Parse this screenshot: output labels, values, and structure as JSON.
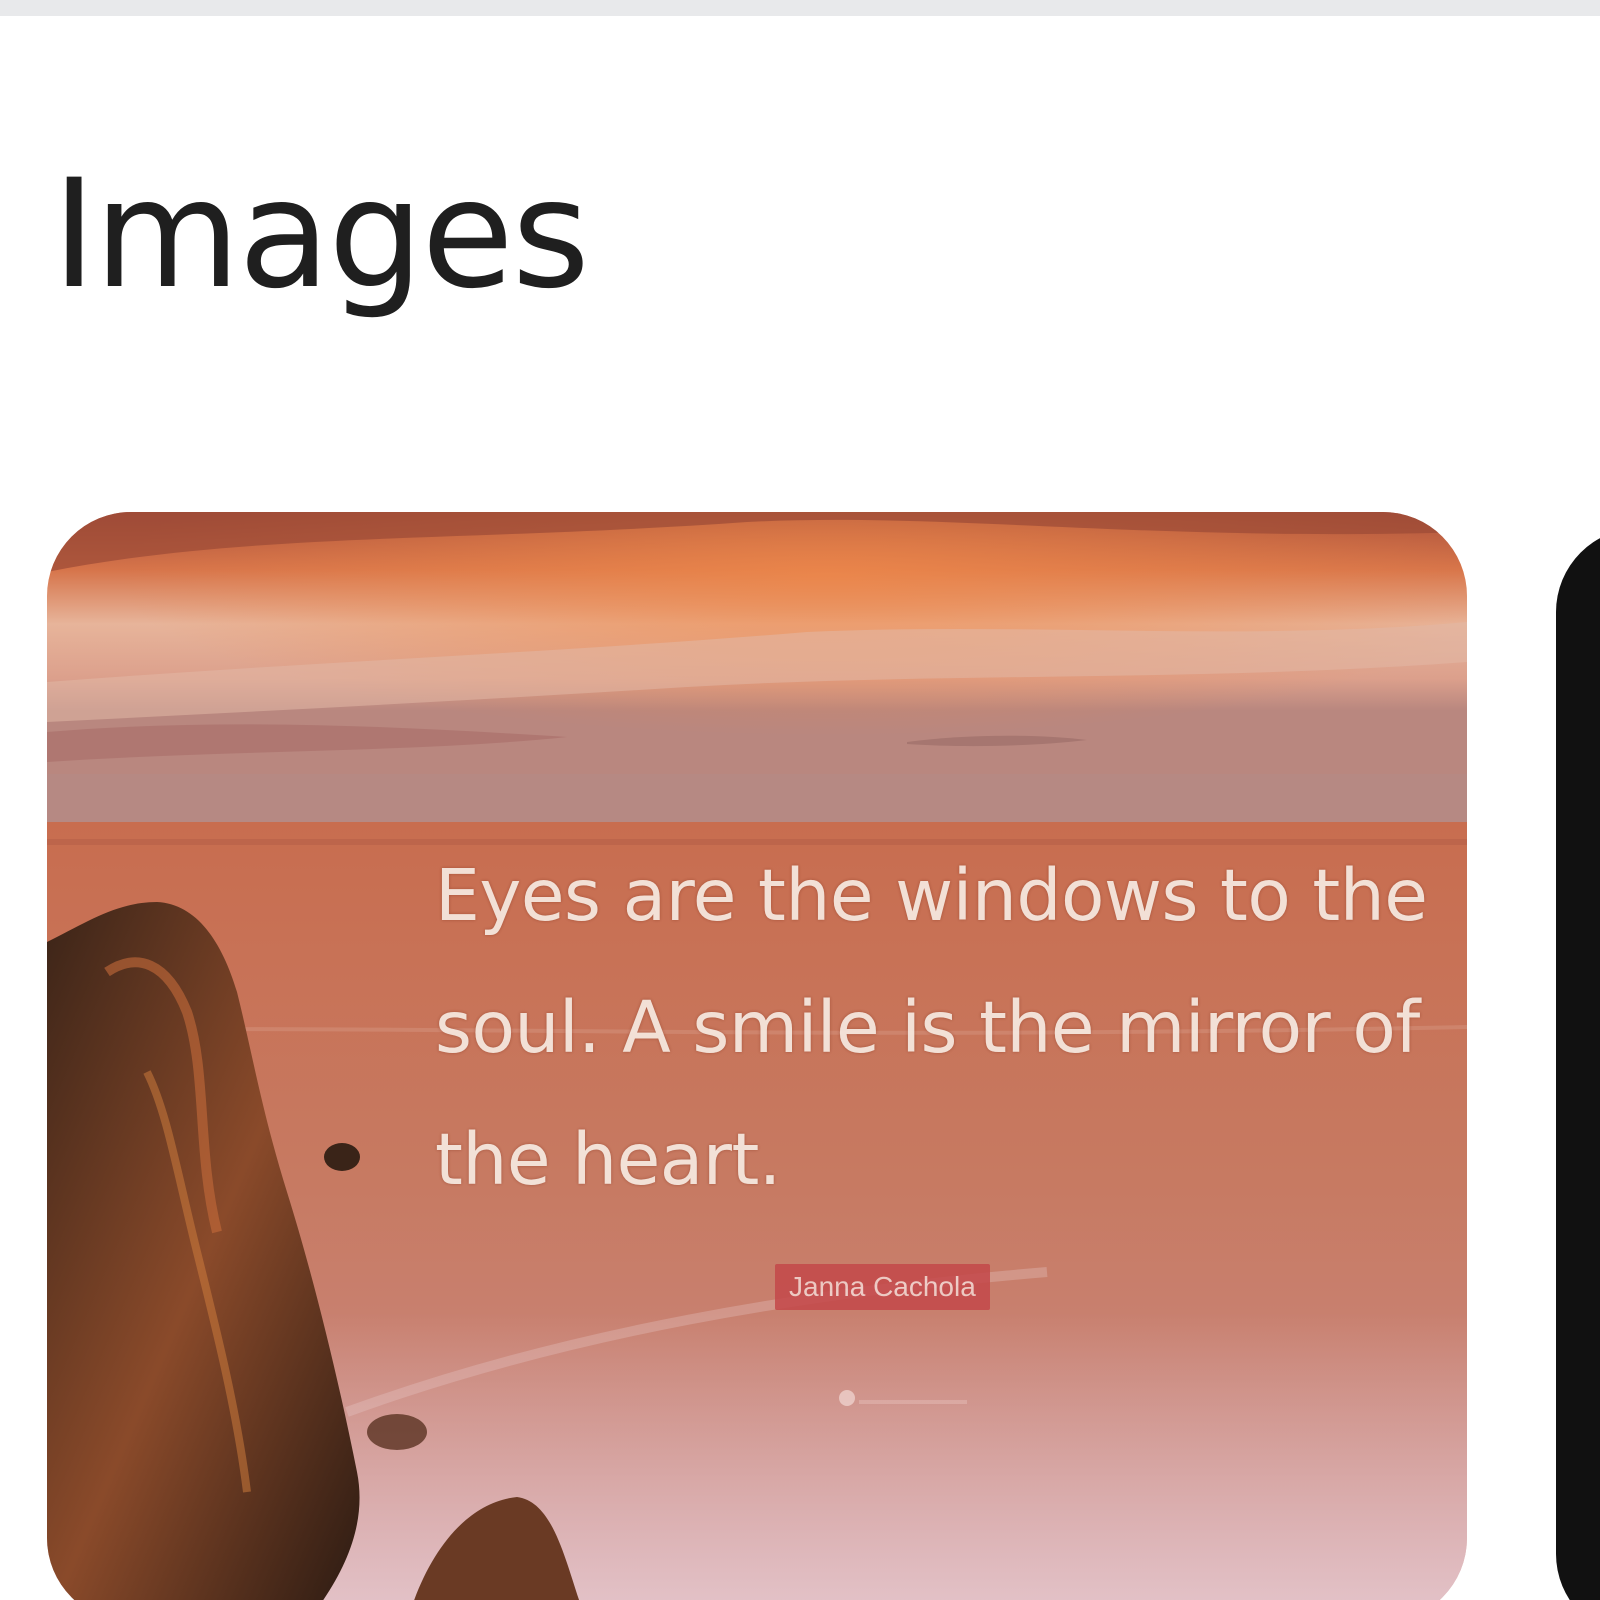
{
  "section": {
    "title": "Images"
  },
  "images": [
    {
      "quote": "Eyes are the windows to the soul. A smile is the mirror of the heart.",
      "author": "Janna Cachola",
      "colors": {
        "sky_top": "#b8614a",
        "sea": "#c97a5e",
        "quote_text": "#f6e9e0",
        "author_badge": "#c4484a"
      }
    }
  ],
  "colors": {
    "title": "#1f1f1f",
    "top_bar": "#e8e9eb",
    "next_card": "#111111"
  }
}
